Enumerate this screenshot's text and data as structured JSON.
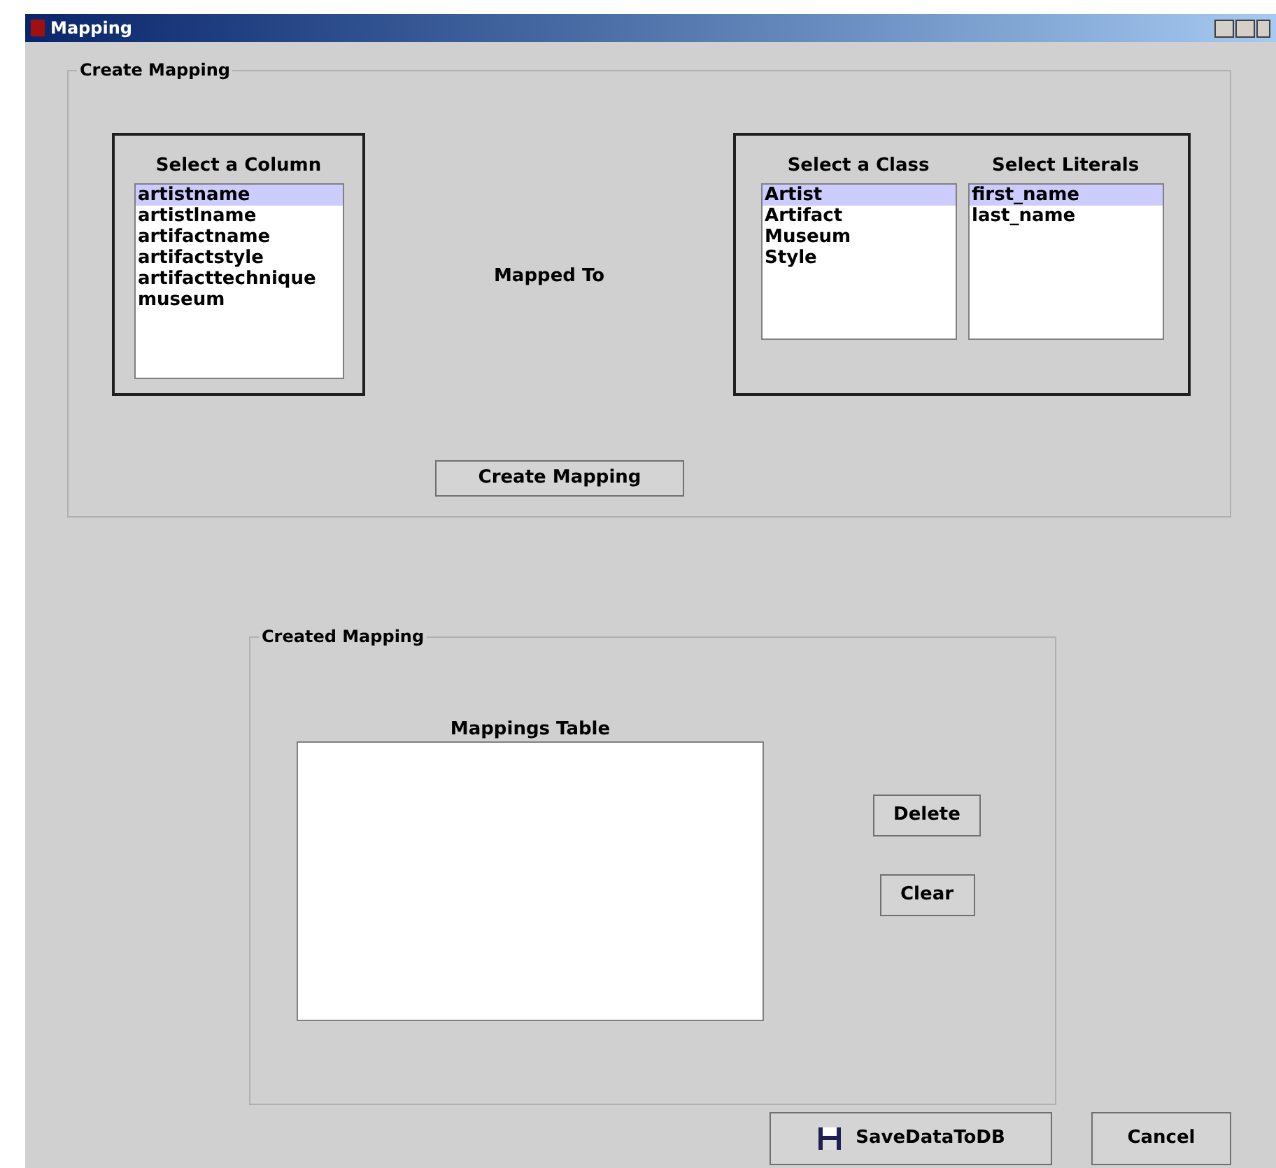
{
  "window": {
    "title": "Mapping"
  },
  "create_mapping": {
    "title": "Create Mapping",
    "column_list": {
      "label": "Select a Column",
      "items": [
        {
          "text": "artistname",
          "selected": true
        },
        {
          "text": "artistlname",
          "selected": false
        },
        {
          "text": "artifactname",
          "selected": false
        },
        {
          "text": "artifactstyle",
          "selected": false
        },
        {
          "text": "artifacttechnique",
          "selected": false
        },
        {
          "text": "museum",
          "selected": false
        }
      ]
    },
    "mapped_to": "Mapped To",
    "class_list": {
      "label": "Select a Class",
      "items": [
        {
          "text": "Artist",
          "selected": true
        },
        {
          "text": "Artifact",
          "selected": false
        },
        {
          "text": "Museum",
          "selected": false
        },
        {
          "text": "Style",
          "selected": false
        }
      ]
    },
    "literals_list": {
      "label": "Select Literals",
      "items": [
        {
          "text": "first_name",
          "selected": true
        },
        {
          "text": "last_name",
          "selected": false
        }
      ]
    },
    "button": "Create Mapping"
  },
  "created_mapping": {
    "title": "Created Mapping",
    "table_label": "Mappings Table",
    "buttons": [
      "Delete",
      "Clear"
    ]
  },
  "footer_buttons": [
    "SaveDataToDB",
    "Cancel"
  ]
}
